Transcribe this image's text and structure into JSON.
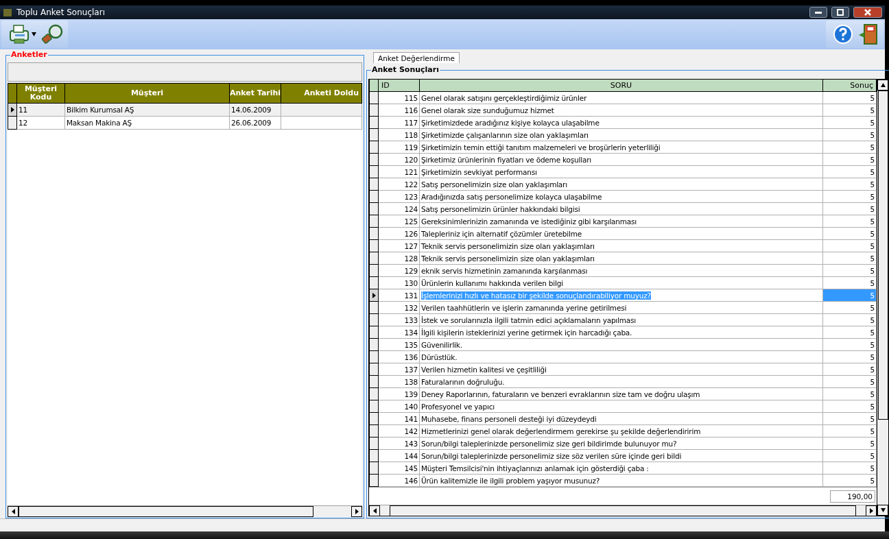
{
  "window": {
    "title": "Toplu Anket Sonuçları"
  },
  "left_panel": {
    "title": "Anketler",
    "columns": [
      "Müşteri Kodu",
      "Müşteri",
      "Anket Tarihi",
      "Anketi Doldu"
    ],
    "rows": [
      {
        "code": "11",
        "customer": "Bilkim Kurumsal AŞ",
        "date": "14.06.2009",
        "selected": true
      },
      {
        "code": "12",
        "customer": "Maksan Makina AŞ",
        "date": "26.06.2009",
        "selected": false
      }
    ]
  },
  "tabs": [
    {
      "label": "Anket Değerlendirme",
      "selected": true
    }
  ],
  "right_panel": {
    "title": "Anket Sonuçları",
    "columns": [
      "ID",
      "SORU",
      "Sonuç"
    ],
    "total": "190,00",
    "rows": [
      {
        "id": "115",
        "question": "Genel olarak satışını gerçekleştirdiğimiz ürünler",
        "result": "5",
        "selected": false
      },
      {
        "id": "116",
        "question": "Genel olarak size sunduğumuz hizmet",
        "result": "5",
        "selected": false
      },
      {
        "id": "117",
        "question": "Şirketimizdede aradığınız kişiye kolayca ulaşabilme",
        "result": "5",
        "selected": false
      },
      {
        "id": "118",
        "question": "Şirketimizde  çalışanlarının size olan yaklaşımları",
        "result": "5",
        "selected": false
      },
      {
        "id": "119",
        "question": "Şirketimizin temin ettiği tanıtım malzemeleri ve broşürlerin yeterliliği",
        "result": "5",
        "selected": false
      },
      {
        "id": "120",
        "question": "Şirketimiz  ürünlerinin fiyatları ve ödeme koşulları",
        "result": "5",
        "selected": false
      },
      {
        "id": "121",
        "question": "Şirketimizin sevkiyat performansı",
        "result": "5",
        "selected": false
      },
      {
        "id": "122",
        "question": "Satış personelimizin size olan yaklaşımları",
        "result": "5",
        "selected": false
      },
      {
        "id": "123",
        "question": "Aradığınızda satış personelimize kolayca ulaşabilme",
        "result": "5",
        "selected": false
      },
      {
        "id": "124",
        "question": "Satış personelimizin ürünler hakkındaki bilgisi",
        "result": "5",
        "selected": false
      },
      {
        "id": "125",
        "question": "Gereksinimlerinizin zamanında ve istediğiniz gibi karşılanması",
        "result": "5",
        "selected": false
      },
      {
        "id": "126",
        "question": "Talepleriniz için alternatif çözümler üretebilme",
        "result": "5",
        "selected": false
      },
      {
        "id": "127",
        "question": "Teknik servis personelimizin size olan yaklaşımları",
        "result": "5",
        "selected": false
      },
      {
        "id": "128",
        "question": "Teknik servis personelimizin size olan yaklaşımları",
        "result": "5",
        "selected": false
      },
      {
        "id": "129",
        "question": "eknik servis hizmetinin zamanında karşılanması",
        "result": "5",
        "selected": false
      },
      {
        "id": "130",
        "question": "Ürünlerin kullanımı hakkında verilen bilgi",
        "result": "5",
        "selected": false
      },
      {
        "id": "131",
        "question": "İşlemlerinizi hızlı ve hatasız bir şekilde sonuçlandırabiliyor muyuz?",
        "result": "5",
        "selected": true
      },
      {
        "id": "132",
        "question": "Verilen taahhütlerin ve işlerin zamanında yerine getirilmesi",
        "result": "5",
        "selected": false
      },
      {
        "id": "133",
        "question": "İstek ve sorularınızla ilgili tatmin edici açıklamaların yapılması",
        "result": "5",
        "selected": false
      },
      {
        "id": "134",
        "question": "İlgili kişilerin isteklerinizi yerine getirmek için harcadığı çaba.",
        "result": "5",
        "selected": false
      },
      {
        "id": "135",
        "question": "Güvenilirlik.",
        "result": "5",
        "selected": false
      },
      {
        "id": "136",
        "question": "Dürüstlük.",
        "result": "5",
        "selected": false
      },
      {
        "id": "137",
        "question": "Verilen hizmetin kalitesi ve çeşitliliği",
        "result": "5",
        "selected": false
      },
      {
        "id": "138",
        "question": "Faturalarının doğruluğu.",
        "result": "5",
        "selected": false
      },
      {
        "id": "139",
        "question": "Deney Raporlarının, faturaların ve benzeri evraklarının size tam ve doğru ulaşım",
        "result": "5",
        "selected": false
      },
      {
        "id": "140",
        "question": "Profesyonel ve yapıcı",
        "result": "5",
        "selected": false
      },
      {
        "id": "141",
        "question": "Muhasebe, finans personeli desteği iyi düzeydeydi",
        "result": "5",
        "selected": false
      },
      {
        "id": "142",
        "question": "Hizmetlerinizi genel olarak değerlendirmem gerekirse şu şekilde değerlendiririm",
        "result": "5",
        "selected": false
      },
      {
        "id": "143",
        "question": "Sorun/bilgi taleplerinizde personelimiz size geri bildirimde bulunuyor mu?",
        "result": "5",
        "selected": false
      },
      {
        "id": "144",
        "question": "Sorun/bilgi taleplerinizde personelimiz size söz verilen süre içinde geri bildi",
        "result": "5",
        "selected": false
      },
      {
        "id": "145",
        "question": "Müşteri Temsilcisi'nin ihtiyaçlarınızı anlamak için gösterdiği çaba :",
        "result": "5",
        "selected": false
      },
      {
        "id": "146",
        "question": "Ürün kalitemizle ile ilgili problem yaşıyor musunuz?",
        "result": "5",
        "selected": false
      }
    ]
  }
}
